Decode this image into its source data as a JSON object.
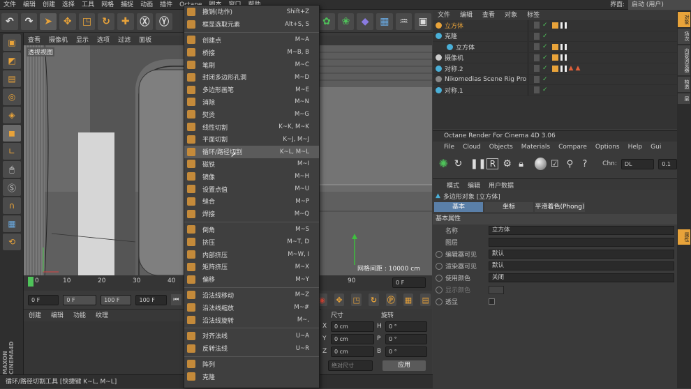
{
  "top_menu": [
    "文件",
    "编辑",
    "创建",
    "选择",
    "工具",
    "网格",
    "捕捉",
    "动画",
    "插件",
    "Octane",
    "脚本",
    "窗口",
    "帮助",
    "界面:",
    "启动 (用户)"
  ],
  "viewport": {
    "menu": [
      "查看",
      "摄像机",
      "显示",
      "选项",
      "过滤",
      "面板"
    ],
    "label": "透视视图",
    "grid_text": "网格间距 : 10000 cm"
  },
  "timeline": {
    "ticks": [
      "0",
      "10",
      "20",
      "30",
      "40",
      "90"
    ],
    "frame_field": "0 F"
  },
  "transport": {
    "start": "0 F",
    "range": "0 F",
    "range2": "100 F",
    "end": "100 F"
  },
  "material_menu": [
    "创建",
    "编辑",
    "功能",
    "纹理"
  ],
  "coords": {
    "headers": [
      "尺寸",
      "旋转"
    ],
    "rows": [
      {
        "axis": "X",
        "size": "0 cm",
        "rot_label": "H",
        "rot": "0 °"
      },
      {
        "axis": "Y",
        "size": "0 cm",
        "rot_label": "P",
        "rot": "0 °"
      },
      {
        "axis": "Z",
        "size": "0 cm",
        "rot_label": "B",
        "rot": "0 °"
      }
    ],
    "mode": "绝对尺寸",
    "apply": "应用"
  },
  "status_text": "循环/路径切割工具 [快捷键 K~L, M~L]",
  "context_menu": {
    "groups": [
      [
        {
          "label": "撤销(动作)",
          "shortcut": "Shift+Z"
        },
        {
          "label": "框显选取元素",
          "shortcut": "Alt+S, S"
        }
      ],
      [
        {
          "label": "创建点",
          "shortcut": "M~A"
        },
        {
          "label": "桥接",
          "shortcut": "M~B, B"
        },
        {
          "label": "笔刷",
          "shortcut": "M~C"
        },
        {
          "label": "封闭多边形孔洞",
          "shortcut": "M~D"
        },
        {
          "label": "多边形画笔",
          "shortcut": "M~E"
        },
        {
          "label": "消除",
          "shortcut": "M~N"
        },
        {
          "label": "熨烫",
          "shortcut": "M~G"
        },
        {
          "label": "线性切割",
          "shortcut": "K~K, M~K"
        },
        {
          "label": "平面切割",
          "shortcut": "K~J, M~J"
        },
        {
          "label": "循环/路径切割",
          "shortcut": "K~L, M~L"
        },
        {
          "label": "磁铁",
          "shortcut": "M~I"
        },
        {
          "label": "镜像",
          "shortcut": "M~H"
        },
        {
          "label": "设置点值",
          "shortcut": "M~U"
        },
        {
          "label": "缝合",
          "shortcut": "M~P"
        },
        {
          "label": "焊接",
          "shortcut": "M~Q"
        }
      ],
      [
        {
          "label": "倒角",
          "shortcut": "M~S"
        },
        {
          "label": "挤压",
          "shortcut": "M~T, D"
        },
        {
          "label": "内部挤压",
          "shortcut": "M~W, I"
        },
        {
          "label": "矩阵挤压",
          "shortcut": "M~X"
        },
        {
          "label": "偏移",
          "shortcut": "M~Y"
        }
      ],
      [
        {
          "label": "沿法线移动",
          "shortcut": "M~Z"
        },
        {
          "label": "沿法线缩放",
          "shortcut": "M~#"
        },
        {
          "label": "沿法线旋转",
          "shortcut": "M~,"
        }
      ],
      [
        {
          "label": "对齐法线",
          "shortcut": "U~A"
        },
        {
          "label": "反转法线",
          "shortcut": "U~R"
        }
      ],
      [
        {
          "label": "阵列",
          "shortcut": ""
        },
        {
          "label": "克隆",
          "shortcut": ""
        }
      ]
    ],
    "highlighted": "循环/路径切割"
  },
  "object_manager": {
    "menu": [
      "文件",
      "编辑",
      "查看",
      "对象",
      "标签"
    ],
    "objects": [
      {
        "name": "立方体",
        "color": "#e8a33a"
      },
      {
        "name": "克隆",
        "color": "#4ab0d8"
      },
      {
        "name": "立方体",
        "color": "#4ab0d8"
      },
      {
        "name": "摄像机",
        "color": "#cccccc"
      },
      {
        "name": "对称.2",
        "color": "#4ab0d8"
      },
      {
        "name": "Nikomedias Scene Rig Pro",
        "color": "#888888"
      },
      {
        "name": "对称.1",
        "color": "#4ab0d8"
      }
    ]
  },
  "octane": {
    "title": "Octane Render For Cinema 4D 3.06",
    "menu": [
      "File",
      "Cloud",
      "Objects",
      "Materials",
      "Compare",
      "Options",
      "Help",
      "Gui"
    ],
    "chn_label": "Chn:",
    "chn_value": "DL",
    "chn_num": "0.1"
  },
  "attributes": {
    "menu": [
      "模式",
      "编辑",
      "用户数据"
    ],
    "object_title": "多边形对象 [立方体]",
    "tabs": [
      "基本",
      "坐标",
      "平滑着色(Phong)"
    ],
    "section": "基本属性",
    "fields": [
      {
        "label": "名称",
        "value": "立方体"
      },
      {
        "label": "图层",
        "value": ""
      },
      {
        "label": "编辑器可见",
        "value": "默认"
      },
      {
        "label": "渲染器可见",
        "value": "默认"
      },
      {
        "label": "使用颜色",
        "value": "关闭"
      },
      {
        "label": "显示颜色",
        "value": ""
      },
      {
        "label": "透显",
        "value": ""
      }
    ]
  },
  "right_tabs": [
    "对象",
    "场次",
    "内容浏览器",
    "构造",
    "层",
    "属性"
  ],
  "brand": "MAXON CINEMA4D"
}
